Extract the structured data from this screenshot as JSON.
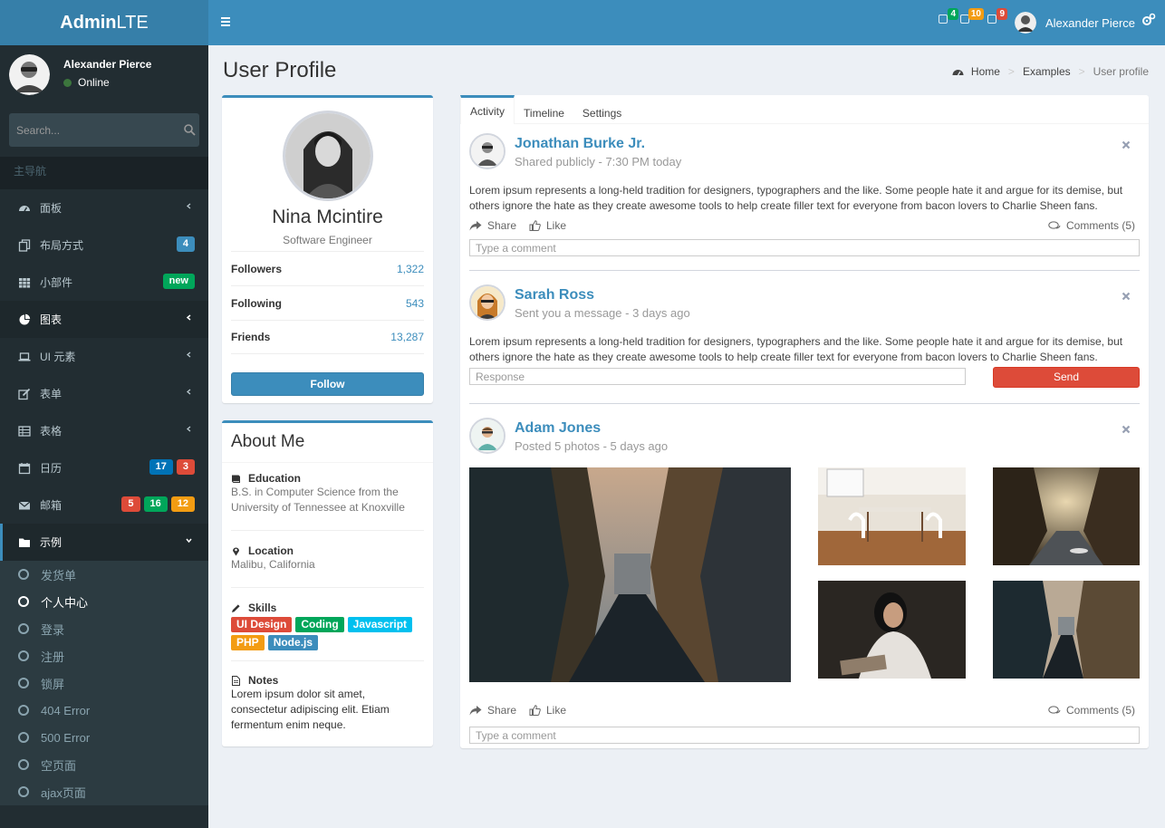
{
  "header": {
    "logo_bold": "Admin",
    "logo_rest": "LTE",
    "notifications": [
      {
        "icon": "mail-icon",
        "count": "4",
        "color": "#00a65a"
      },
      {
        "icon": "bell-icon",
        "count": "10",
        "color": "#f39c12"
      },
      {
        "icon": "flag-icon",
        "count": "9",
        "color": "#dd4b39"
      }
    ],
    "user_name": "Alexander Pierce"
  },
  "sidebar": {
    "user_name": "Alexander Pierce",
    "status": "Online",
    "search_placeholder": "Search...",
    "section_header": "主导航",
    "items": [
      {
        "label": "面板",
        "icon": "dashboard-icon"
      },
      {
        "label": "布局方式",
        "icon": "files-icon",
        "badges": [
          {
            "text": "4",
            "color": "bg-blue"
          }
        ]
      },
      {
        "label": "小部件",
        "icon": "th-icon",
        "badges": [
          {
            "text": "new",
            "color": "bg-green"
          }
        ]
      },
      {
        "label": "图表",
        "icon": "pie-chart-icon"
      },
      {
        "label": "UI 元素",
        "icon": "laptop-icon"
      },
      {
        "label": "表单",
        "icon": "edit-icon"
      },
      {
        "label": "表格",
        "icon": "table-icon"
      },
      {
        "label": "日历",
        "icon": "calendar-icon",
        "badges": [
          {
            "text": "17",
            "color": "bg-light-blue"
          },
          {
            "text": "3",
            "color": "bg-red"
          }
        ]
      },
      {
        "label": "邮箱",
        "icon": "envelope-icon",
        "badges": [
          {
            "text": "5",
            "color": "bg-red"
          },
          {
            "text": "16",
            "color": "bg-green"
          },
          {
            "text": "12",
            "color": "bg-yellow"
          }
        ]
      },
      {
        "label": "示例",
        "icon": "folder-icon"
      }
    ],
    "subitems": [
      "发货单",
      "个人中心",
      "登录",
      "注册",
      "锁屏",
      "404 Error",
      "500 Error",
      "空页面",
      "ajax页面"
    ],
    "active_subitem": "个人中心"
  },
  "page": {
    "title": "User Profile",
    "breadcrumb": [
      "Home",
      "Examples",
      "User profile"
    ]
  },
  "profile": {
    "name": "Nina Mcintire",
    "role": "Software Engineer",
    "stats": [
      {
        "label": "Followers",
        "value": "1,322"
      },
      {
        "label": "Following",
        "value": "543"
      },
      {
        "label": "Friends",
        "value": "13,287"
      }
    ],
    "follow_label": "Follow"
  },
  "about": {
    "title": "About Me",
    "education_title": "Education",
    "education_text": "B.S. in Computer Science from the University of Tennessee at Knoxville",
    "location_title": "Location",
    "location_text": "Malibu, California",
    "skills_title": "Skills",
    "skills": [
      {
        "text": "UI Design",
        "color": "bg-danger"
      },
      {
        "text": "Coding",
        "color": "bg-success"
      },
      {
        "text": "Javascript",
        "color": "bg-info"
      },
      {
        "text": "PHP",
        "color": "bg-warning"
      },
      {
        "text": "Node.js",
        "color": "bg-primary"
      }
    ],
    "notes_title": "Notes",
    "notes_text": "Lorem ipsum dolor sit amet, consectetur adipiscing elit. Etiam fermentum enim neque."
  },
  "tabs": [
    "Activity",
    "Timeline",
    "Settings"
  ],
  "posts": [
    {
      "name": "Jonathan Burke Jr.",
      "desc": "Shared publicly - 7:30 PM today",
      "text": "Lorem ipsum represents a long-held tradition for designers, typographers and the like. Some people hate it and argue for its demise, but others ignore the hate as they create awesome tools to help create filler text for everyone from bacon lovers to Charlie Sheen fans.",
      "share": "Share",
      "like": "Like",
      "comments": "Comments (5)",
      "comment_placeholder": "Type a comment"
    },
    {
      "name": "Sarah Ross",
      "desc": "Sent you a message - 3 days ago",
      "text": "Lorem ipsum represents a long-held tradition for designers, typographers and the like. Some people hate it and argue for its demise, but others ignore the hate as they create awesome tools to help create filler text for everyone from bacon lovers to Charlie Sheen fans.",
      "response_placeholder": "Response",
      "send": "Send"
    },
    {
      "name": "Adam Jones",
      "desc": "Posted 5 photos - 5 days ago",
      "share": "Share",
      "like": "Like",
      "comments": "Comments (5)",
      "comment_placeholder": "Type a comment"
    }
  ]
}
